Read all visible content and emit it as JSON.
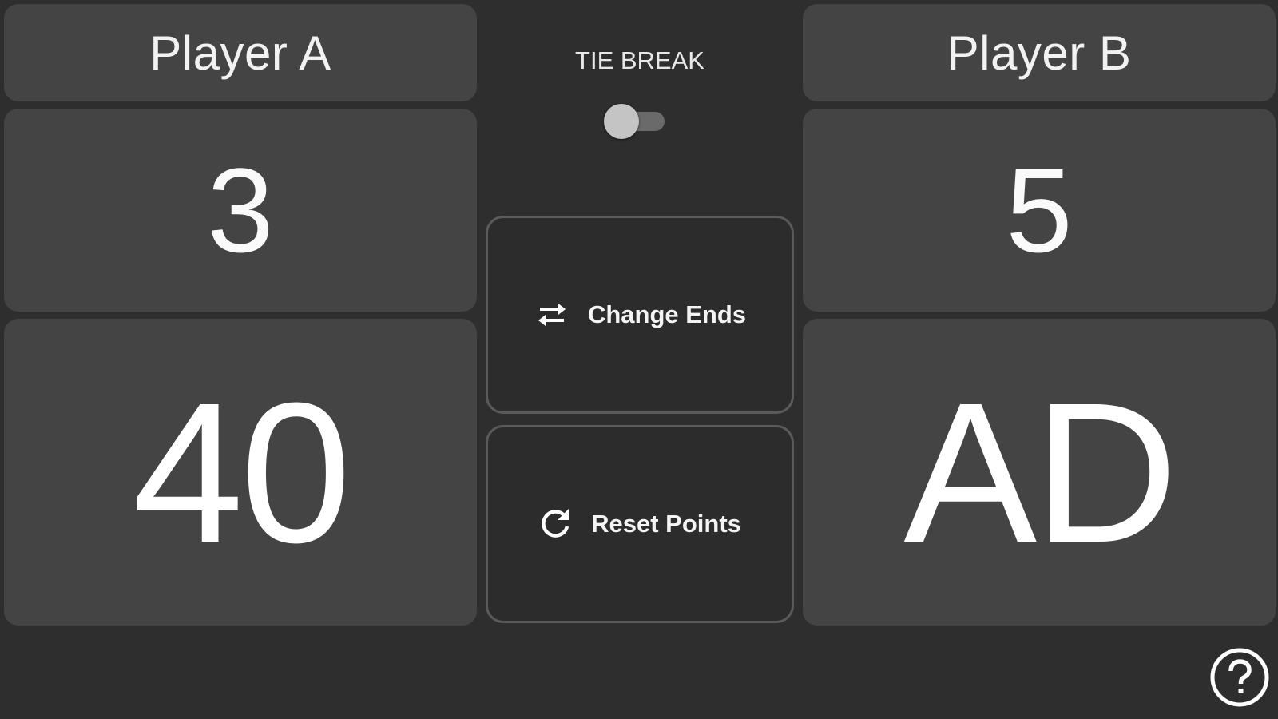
{
  "players": {
    "a": {
      "name": "Player A",
      "games": "3",
      "points": "40"
    },
    "b": {
      "name": "Player B",
      "games": "5",
      "points": "AD"
    }
  },
  "tie_break": {
    "label": "TIE BREAK",
    "enabled": false
  },
  "actions": {
    "change_ends": {
      "label": "Change Ends",
      "icon": "swap-horizontal-icon"
    },
    "reset_points": {
      "label": "Reset Points",
      "icon": "refresh-icon"
    }
  },
  "help": {
    "icon": "help-circle-icon"
  },
  "colors": {
    "background": "#2e2e2e",
    "tile": "#444444",
    "text": "#ffffff",
    "button_border": "#5a5a5a"
  }
}
